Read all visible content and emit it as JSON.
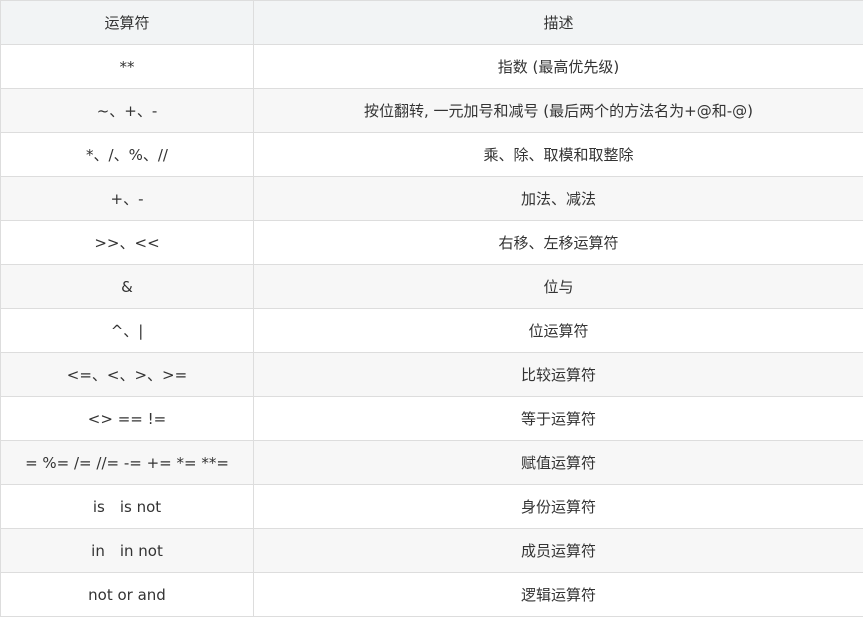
{
  "table": {
    "headers": [
      "运算符",
      "描述"
    ],
    "rows": [
      {
        "operator": "**",
        "description": "指数 (最高优先级)"
      },
      {
        "operator": "~、+、-",
        "description": "按位翻转, 一元加号和减号 (最后两个的方法名为+@和-@)"
      },
      {
        "operator": "*、/、%、//",
        "description": "乘、除、取模和取整除"
      },
      {
        "operator": "+、-",
        "description": "加法、减法"
      },
      {
        "operator": ">>、<<",
        "description": "右移、左移运算符"
      },
      {
        "operator": "&",
        "description": "位与"
      },
      {
        "operator": "^、|",
        "description": "位运算符"
      },
      {
        "operator": "<=、<、>、>=",
        "description": "比较运算符"
      },
      {
        "operator": "<> == !=",
        "description": "等于运算符"
      },
      {
        "operator": "= %= /= //= -= += *= **=",
        "description": "赋值运算符"
      },
      {
        "operator": "is　is not",
        "description": "身份运算符"
      },
      {
        "operator": "in　in not",
        "description": "成员运算符"
      },
      {
        "operator": "not  or  and",
        "description": "逻辑运算符"
      }
    ]
  }
}
